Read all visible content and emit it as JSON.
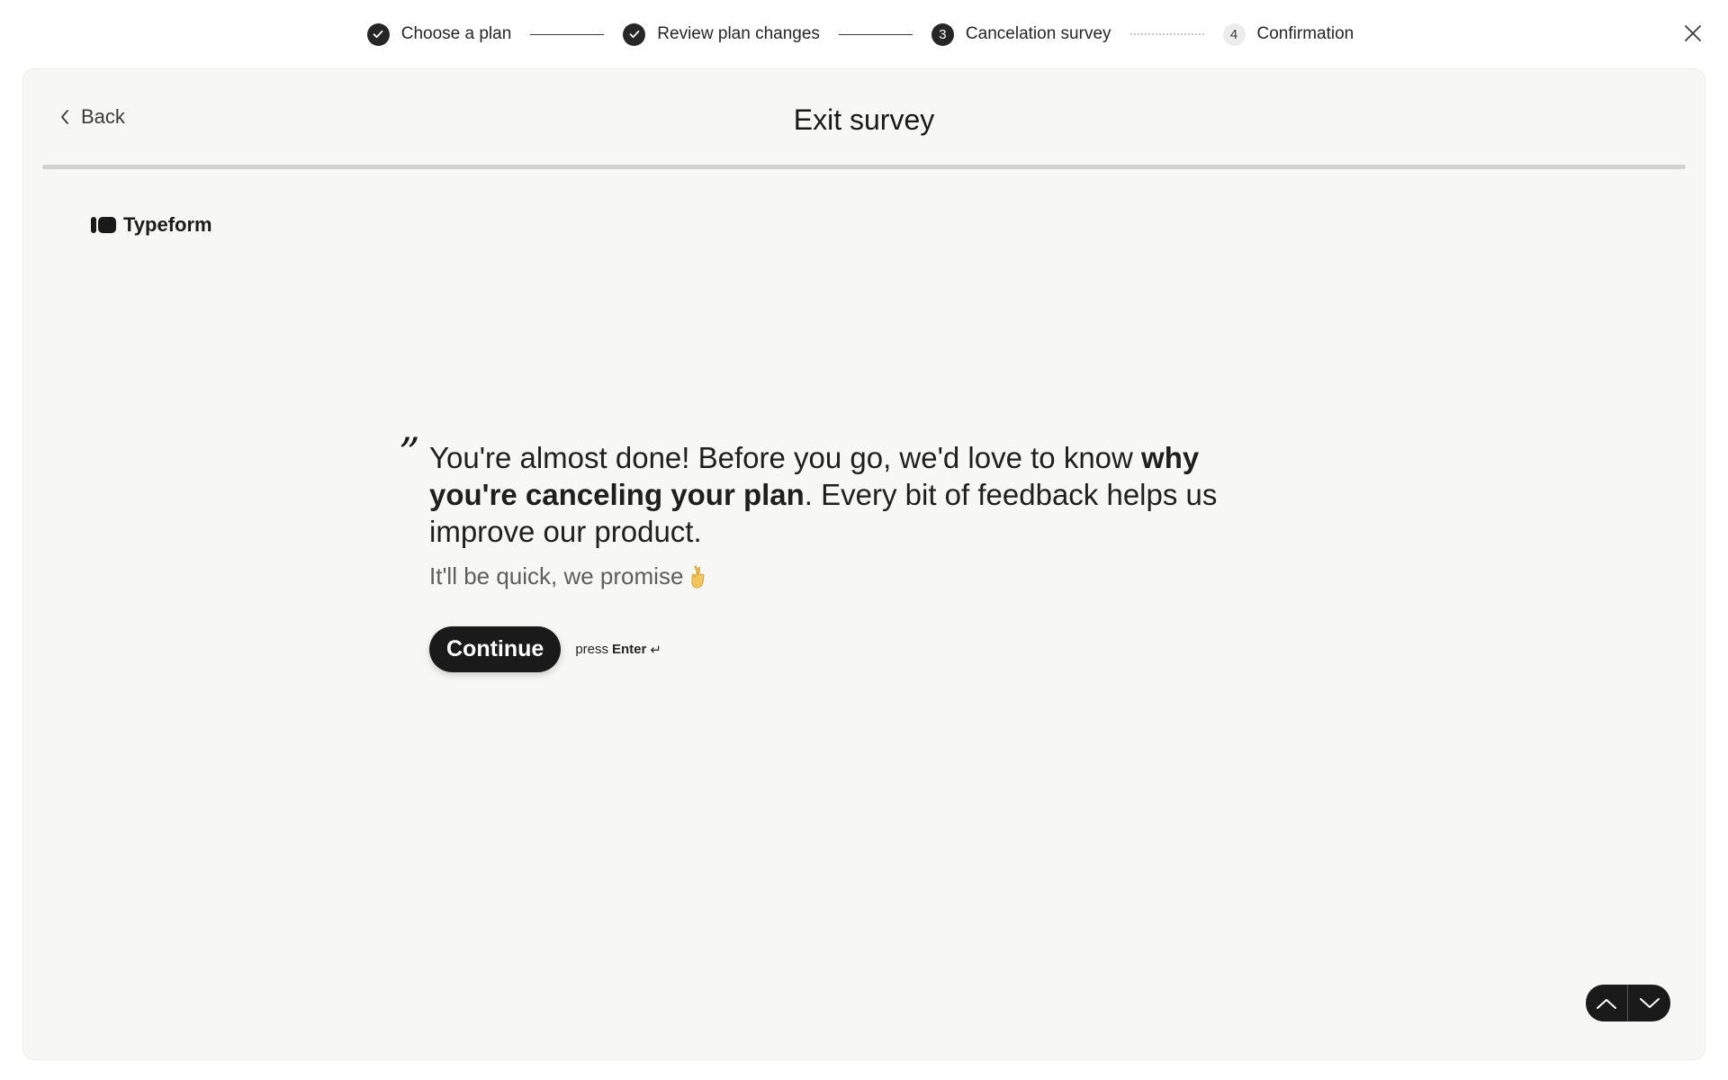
{
  "stepper": {
    "steps": [
      {
        "label": "Choose a plan",
        "state": "done",
        "icon": "check-icon"
      },
      {
        "label": "Review plan changes",
        "state": "done",
        "icon": "check-icon"
      },
      {
        "label": "Cancelation survey",
        "state": "current",
        "number": "3"
      },
      {
        "label": "Confirmation",
        "state": "upcoming",
        "number": "4"
      }
    ]
  },
  "header": {
    "back_label": "Back",
    "title": "Exit survey"
  },
  "form": {
    "brand": "Typeform",
    "quote_mark": "”",
    "question_part1": "You're almost done! Before you go, we'd love to know ",
    "question_bold": "why you're canceling your plan",
    "question_part2": ". Every bit of feedback helps us improve our product.",
    "subtext": "It'll be quick, we promise",
    "subtext_emoji": "crossed-fingers-icon",
    "continue_label": "Continue",
    "press_label": "press",
    "enter_label": "Enter",
    "enter_glyph": "↵"
  },
  "colors": {
    "accent": "#1a1a1a",
    "card_bg": "#f7f7f6",
    "progress_track": "#d2d2d1"
  }
}
